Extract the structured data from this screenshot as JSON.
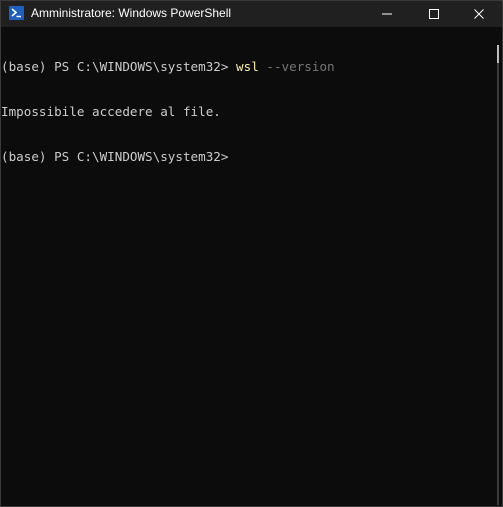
{
  "window": {
    "title": "Amministratore: Windows PowerShell",
    "icon": "powershell-icon",
    "controls": [
      "minimize-icon",
      "maximize-icon",
      "close-icon"
    ]
  },
  "console": {
    "line1": {
      "prompt": "(base) PS C:\\WINDOWS\\system32> ",
      "command": "wsl",
      "parameter": " --version"
    },
    "line2": {
      "output": "Impossibile accedere al file."
    },
    "line3": {
      "prompt": "(base) PS C:\\WINDOWS\\system32>"
    }
  },
  "colors": {
    "background": "#0c0c0c",
    "text": "#cccccc",
    "command": "#f9f1a5",
    "parameter": "#767676",
    "titlebar": "#202020"
  }
}
